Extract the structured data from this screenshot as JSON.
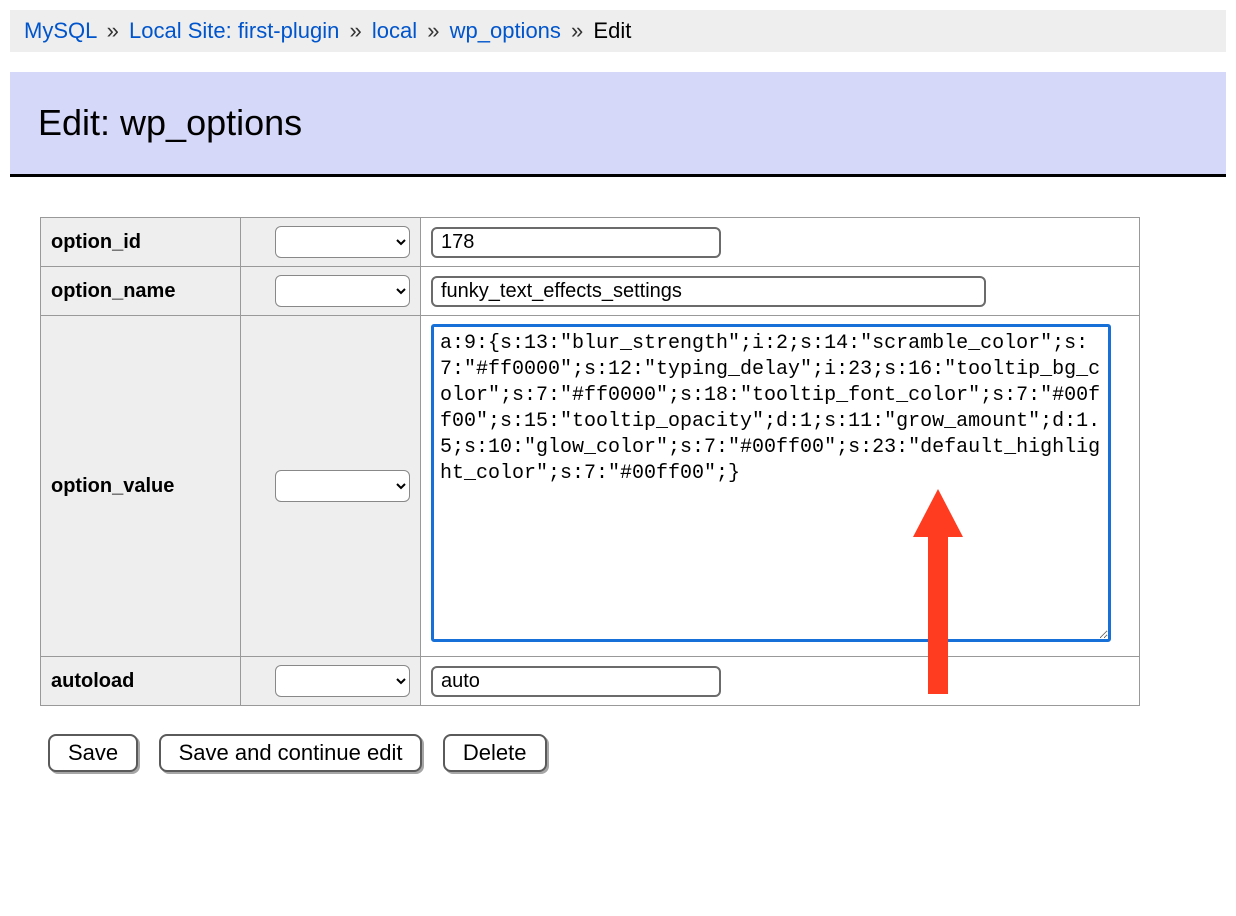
{
  "breadcrumb": {
    "items": [
      {
        "label": "MySQL",
        "href": "#"
      },
      {
        "label": "Local Site: first-plugin",
        "href": "#"
      },
      {
        "label": "local",
        "href": "#"
      },
      {
        "label": "wp_options",
        "href": "#"
      }
    ],
    "current": "Edit",
    "separator": "»"
  },
  "heading": "Edit: wp_options",
  "fields": {
    "option_id": {
      "label": "option_id",
      "value": "178"
    },
    "option_name": {
      "label": "option_name",
      "value": "funky_text_effects_settings"
    },
    "option_value": {
      "label": "option_value",
      "value": "a:9:{s:13:\"blur_strength\";i:2;s:14:\"scramble_color\";s:7:\"#ff0000\";s:12:\"typing_delay\";i:23;s:16:\"tooltip_bg_color\";s:7:\"#ff0000\";s:18:\"tooltip_font_color\";s:7:\"#00ff00\";s:15:\"tooltip_opacity\";d:1;s:11:\"grow_amount\";d:1.5;s:10:\"glow_color\";s:7:\"#00ff00\";s:23:\"default_highlight_color\";s:7:\"#00ff00\";}"
    },
    "autoload": {
      "label": "autoload",
      "value": "auto"
    }
  },
  "buttons": {
    "save": "Save",
    "save_continue": "Save and continue edit",
    "delete": "Delete"
  }
}
